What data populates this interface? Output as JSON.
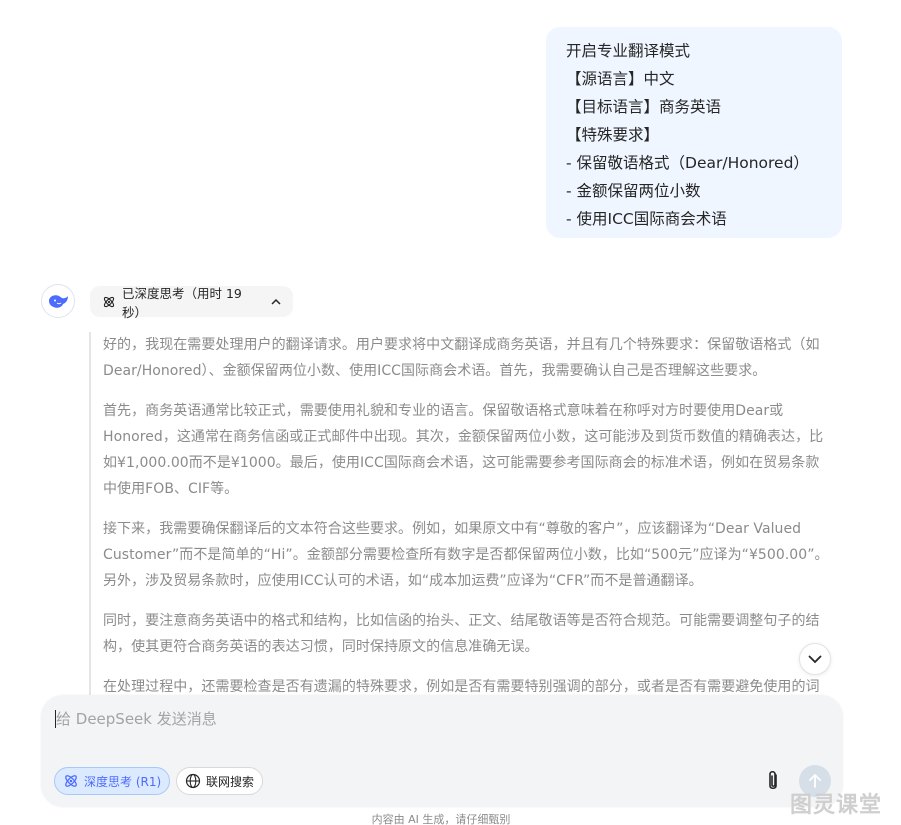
{
  "user_message": {
    "lines": [
      "开启专业翻译模式",
      "【源语言】中文",
      "【目标语言】商务英语",
      "【特殊要求】",
      "- 保留敬语格式（Dear/Honored）",
      "- 金额保留两位小数",
      "- 使用ICC国际商会术语"
    ]
  },
  "assistant": {
    "avatar_icon": "deepseek-whale-icon",
    "thinking_label": "已深度思考（用时 19 秒）",
    "reasoning": [
      "好的，我现在需要处理用户的翻译请求。用户要求将中文翻译成商务英语，并且有几个特殊要求：保留敬语格式（如Dear/Honored）、金额保留两位小数、使用ICC国际商会术语。首先，我需要确认自己是否理解这些要求。",
      "首先，商务英语通常比较正式，需要使用礼貌和专业的语言。保留敬语格式意味着在称呼对方时要使用Dear或Honored，这通常在商务信函或正式邮件中出现。其次，金额保留两位小数，这可能涉及到货币数值的精确表达，比如¥1,000.00而不是¥1000。最后，使用ICC国际商会术语，这可能需要参考国际商会的标准术语，例如在贸易条款中使用FOB、CIF等。",
      "接下来，我需要确保翻译后的文本符合这些要求。例如，如果原文中有“尊敬的客户”，应该翻译为“Dear Valued Customer”而不是简单的“Hi”。金额部分需要检查所有数字是否都保留两位小数，比如“500元”应译为“¥500.00”。另外，涉及贸易条款时，应使用ICC认可的术语，如“成本加运费”应译为“CFR”而不是普通翻译。",
      "同时，要注意商务英语中的格式和结构，比如信函的抬头、正文、结尾敬语等是否符合规范。可能需要调整句子的结构，使其更符合商务英语的表达习惯，同时保持原文的信息准确无误。",
      "在处理过程中，还需要检查是否有遗漏的特殊要求，例如是否有需要特别强调的部分，或者是否有需要避免使用的词"
    ]
  },
  "composer": {
    "placeholder": "给 DeepSeek 发送消息",
    "deep_think_label": "深度思考 (R1)",
    "web_search_label": "联网搜索"
  },
  "footer": {
    "disclaimer": "内容由 AI 生成，请仔细甄别"
  },
  "watermark": "图灵课堂",
  "colors": {
    "accent": "#4d6bfe",
    "user_bubble": "#eff6ff",
    "reasoning_text": "#8b8b8b"
  }
}
